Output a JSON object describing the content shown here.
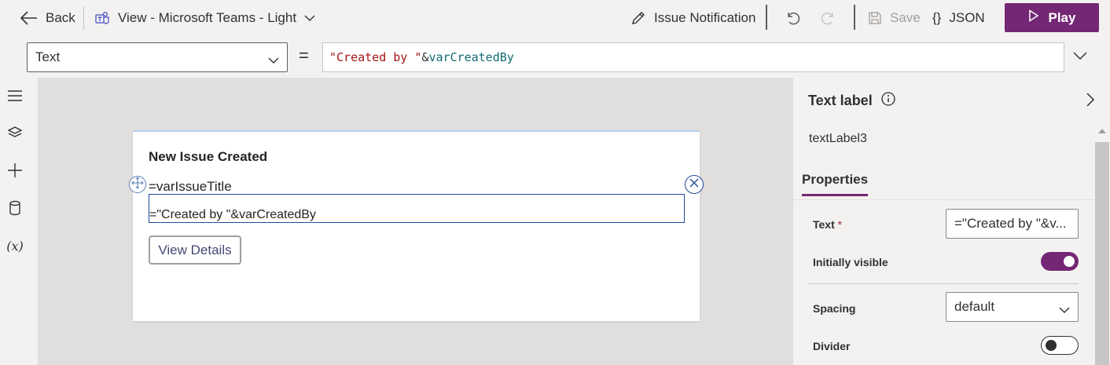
{
  "toolbar": {
    "back_label": "Back",
    "view_label": "View - Microsoft Teams - Light",
    "issue_label": "Issue Notification",
    "save_label": "Save",
    "json_label": "JSON",
    "play_label": "Play"
  },
  "formula_bar": {
    "property": "Text",
    "equals": "=",
    "formula_string": "\"Created by \"",
    "formula_operator": "&",
    "formula_variable": "varCreatedBy"
  },
  "left_rail": {
    "fx_label": "(x)"
  },
  "canvas": {
    "card_title": "New Issue Created",
    "issue_text": "=varIssueTitle",
    "created_text": "=\"Created by \"&varCreatedBy",
    "button_label": "View Details"
  },
  "right_panel": {
    "title": "Text label",
    "control_name": "textLabel3",
    "tab_properties": "Properties",
    "props": {
      "text_label": "Text",
      "text_required": "*",
      "text_value": "=\"Created by \"&v...",
      "visible_label": "Initially visible",
      "visible_on": true,
      "spacing_label": "Spacing",
      "spacing_value": "default",
      "divider_label": "Divider",
      "divider_on": false
    }
  },
  "colors": {
    "brand": "#742774",
    "selection": "#1f4b99"
  },
  "icons": [
    "back-arrow-icon",
    "teams-icon",
    "chevron-down-icon",
    "pencil-icon",
    "undo-icon",
    "redo-icon",
    "save-icon",
    "json-braces-icon",
    "play-icon",
    "hamburger-icon",
    "layers-icon",
    "plus-icon",
    "database-icon",
    "variables-icon",
    "move-icon",
    "close-icon",
    "info-icon",
    "chevron-right-icon"
  ]
}
